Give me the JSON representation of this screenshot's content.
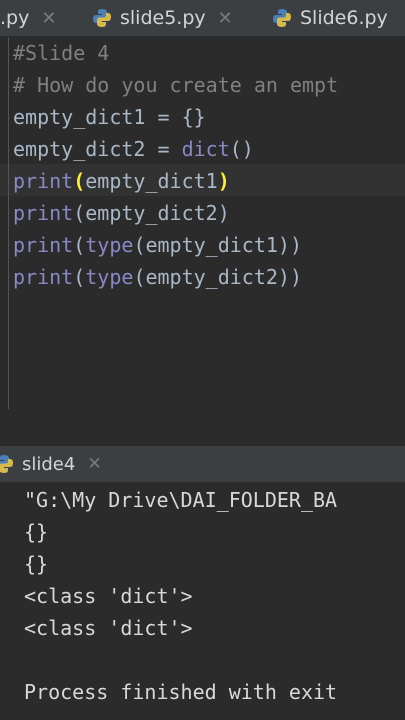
{
  "tabs": [
    {
      "label": ".py"
    },
    {
      "label": "slide5.py"
    },
    {
      "label": "Slide6.py"
    }
  ],
  "editor": {
    "lines": [
      "#Slide 4",
      "# How do you create an empt",
      "empty_dict1 = {}",
      "empty_dict2 = dict()",
      "print(empty_dict1)",
      "print(empty_dict2)",
      "print(type(empty_dict1))",
      "print(type(empty_dict2))"
    ]
  },
  "run": {
    "tab_label": "slide4",
    "output": [
      "\"G:\\My Drive\\DAI_FOLDER_BA",
      "{}",
      "{}",
      "<class 'dict'>",
      "<class 'dict'>",
      "",
      "Process finished with exit"
    ]
  },
  "colors": {
    "background": "#2b2b2b",
    "tabbar": "#3c3f41",
    "builtin": "#8888c6",
    "comment": "#808080",
    "text": "#a9b7c6",
    "bracket_match": "#ffef28"
  }
}
